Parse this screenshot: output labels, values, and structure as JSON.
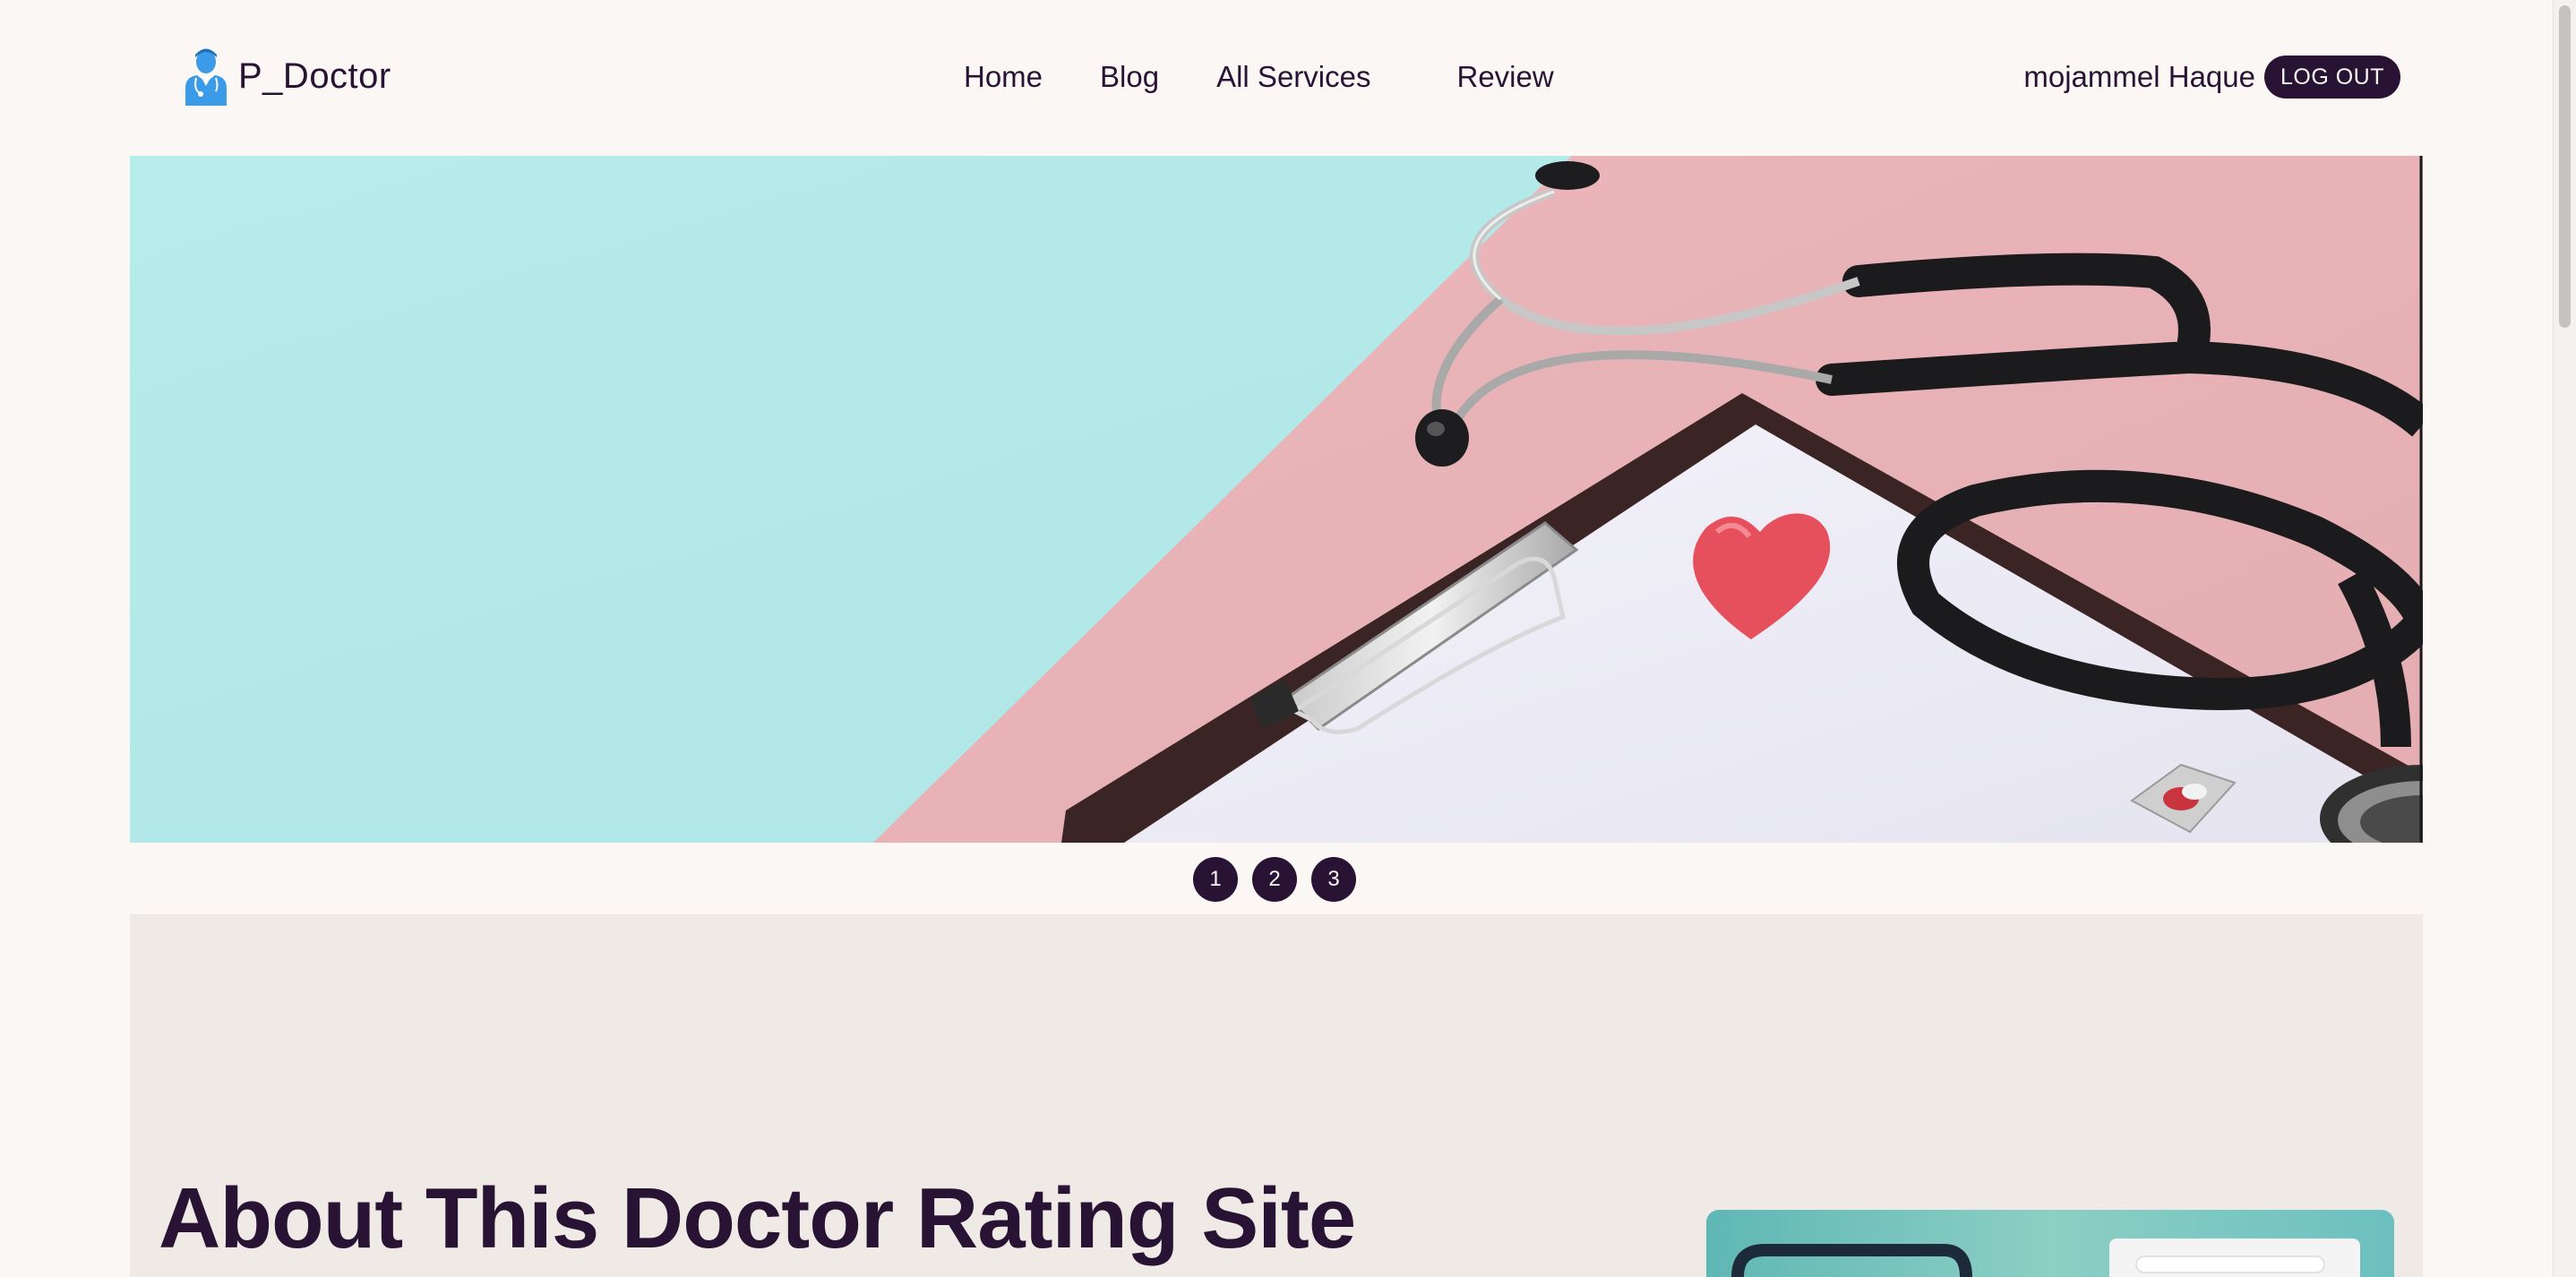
{
  "brand": {
    "name": "P_Doctor",
    "logo_icon": "doctor-icon",
    "logo_color": "#3b9be8"
  },
  "nav": {
    "links": [
      {
        "label": "Home"
      },
      {
        "label": "Blog"
      },
      {
        "label": "All Services"
      },
      {
        "label": "Review"
      }
    ]
  },
  "user": {
    "name": "mojammel Haque",
    "logout_label": "LOG OUT"
  },
  "carousel": {
    "slide_description_icon": "stethoscope-clipboard-heart-image",
    "dots": [
      "1",
      "2",
      "3"
    ]
  },
  "about": {
    "title": "About This Doctor Rating Site"
  },
  "colors": {
    "primary": "#291334",
    "background": "#faf7f5",
    "section_bg": "#efeae6",
    "hero_teal": "#b5ecec",
    "hero_pink": "#e9b5b8"
  }
}
